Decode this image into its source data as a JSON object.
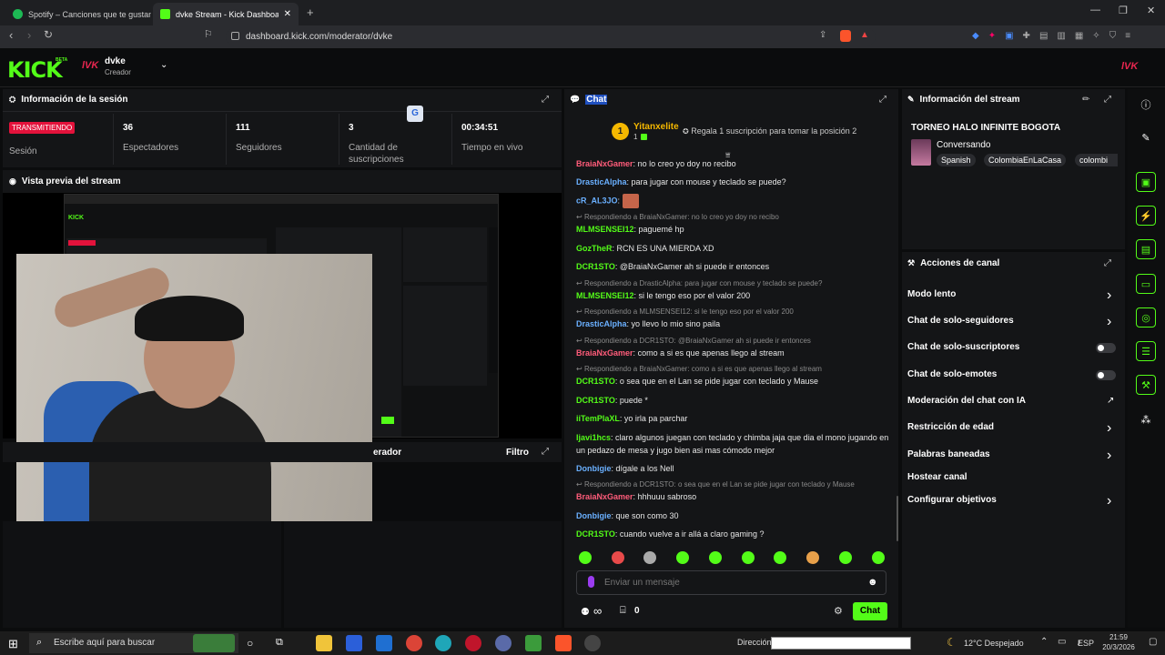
{
  "browser": {
    "tabs": [
      {
        "title": "Spotify – Canciones que te gustan",
        "color": "#1db954"
      },
      {
        "title": "dvke Stream - Kick Dashboard",
        "color": "#53fc18"
      }
    ],
    "url": "dashboard.kick.com/moderator/dvke"
  },
  "header": {
    "logo": "KICK",
    "beta": "BETA",
    "user_badge": "lVK",
    "username": "dvke",
    "role": "Creador",
    "right_badge": "lVK"
  },
  "session": {
    "title": "Información de la sesión",
    "status": "TRANSMITIENDO",
    "status_label": "Sesión",
    "stats": [
      {
        "value": "36",
        "label": "Espectadores"
      },
      {
        "value": "111",
        "label": "Seguidores"
      },
      {
        "value": "3",
        "label": "Cantidad de suscripciones"
      },
      {
        "value": "00:34:51",
        "label": "Tiempo en vivo"
      }
    ]
  },
  "preview": {
    "title": "Vista previa del stream"
  },
  "lower_panel": {
    "title": "erador",
    "filter": "Filtro"
  },
  "chat": {
    "title": "Chat",
    "pinned_user": "Yitanxelite",
    "pinned_rank": "1",
    "pinned_count": "1",
    "pinned_text": "Regala 1 suscripción para tomar la posición 2",
    "messages": [
      {
        "user": "BraiaNxGamer",
        "color": "#ff5c7a",
        "text": "no lo creo yo doy no recibo"
      },
      {
        "user": "DrasticAlpha",
        "color": "#6ab0ff",
        "text": "para jugar con mouse y teclado se puede?"
      },
      {
        "user": "cR_AL3JO",
        "color": "#6ab0ff",
        "text": ""
      },
      {
        "reply": "Respondiendo a BraiaNxGamer: no lo creo yo doy no recibo"
      },
      {
        "user": "MLMSENSEI12",
        "color": "#53fc18",
        "text": "paguemé hp"
      },
      {
        "user": "GozTheR",
        "color": "#53fc18",
        "text": "RCN ES UNA MIERDA XD"
      },
      {
        "user": "DCR1STO",
        "color": "#53fc18",
        "text": "@BraiaNxGamer ah si puede ir entonces"
      },
      {
        "reply": "Respondiendo a DrasticAlpha: para jugar con mouse y teclado se puede?"
      },
      {
        "user": "MLMSENSEI12",
        "color": "#53fc18",
        "text": "si le tengo eso por el valor 200"
      },
      {
        "reply": "Respondiendo a MLMSENSEI12: si le tengo eso por el valor 200"
      },
      {
        "user": "DrasticAlpha",
        "color": "#6ab0ff",
        "text": "yo llevo lo mio sino paila"
      },
      {
        "reply": "Respondiendo a DCR1STO: @BraiaNxGamer ah si puede ir entonces"
      },
      {
        "user": "BraiaNxGamer",
        "color": "#ff5c7a",
        "text": "como a si es que apenas llego al stream"
      },
      {
        "reply": "Respondiendo a BraiaNxGamer: como a si es que apenas llego al stream"
      },
      {
        "user": "DCR1STO",
        "color": "#53fc18",
        "text": "o sea que en el Lan se pide jugar con teclado y Mause"
      },
      {
        "user": "DCR1STO",
        "color": "#53fc18",
        "text": "puede *"
      },
      {
        "user": "iiTemPlaXL",
        "color": "#53fc18",
        "text": "yo irla pa parchar"
      },
      {
        "user": "ljavi1hcs",
        "color": "#53fc18",
        "text": "claro algunos juegan con teclado y chimba jaja que dia el mono jugando en un pedazo de mesa y jugo bien asi mas cómodo mejor"
      },
      {
        "user": "Donbigie",
        "color": "#6ab0ff",
        "text": "dígale a los Nell"
      },
      {
        "reply": "Respondiendo a DCR1STO: o sea que en el Lan se pide jugar con teclado y Mause"
      },
      {
        "user": "BraiaNxGamer",
        "color": "#ff5c7a",
        "text": "hhhuuu sabroso"
      },
      {
        "user": "Donbigie",
        "color": "#6ab0ff",
        "text": "que son como 30"
      },
      {
        "user": "DCR1STO",
        "color": "#53fc18",
        "text": "cuando vuelve a ir allá a claro gaming ?"
      }
    ],
    "input_placeholder": "Enviar un mensaje",
    "infinity": "∞",
    "gift_count": "0",
    "send_label": "Chat"
  },
  "stream_info": {
    "title": "Información del stream",
    "stream_title": "TORNEO HALO INFINITE BOGOTA",
    "category": "Conversando",
    "tags": [
      "Spanish",
      "ColombiaEnLaCasa",
      "colombi"
    ]
  },
  "channel_actions": {
    "title": "Acciones de canal",
    "items": [
      {
        "label": "Modo lento",
        "control": "chevron"
      },
      {
        "label": "Chat de solo-seguidores",
        "control": "chevron"
      },
      {
        "label": "Chat de solo-suscriptores",
        "control": "toggle"
      },
      {
        "label": "Chat de solo-emotes",
        "control": "toggle"
      },
      {
        "label": "Moderación del chat con IA",
        "control": "external"
      },
      {
        "label": "Restricción de edad",
        "control": "chevron"
      },
      {
        "label": "Palabras baneadas",
        "control": "chevron"
      },
      {
        "label": "Hostear canal",
        "control": "none"
      },
      {
        "label": "Configurar objetivos",
        "control": "chevron"
      }
    ]
  },
  "taskbar": {
    "search_placeholder": "Escribe aquí para buscar",
    "address_label": "Dirección",
    "weather": "12°C  Despejado",
    "lang": "ESP",
    "time": "21:59",
    "date": "20/3/2026"
  }
}
